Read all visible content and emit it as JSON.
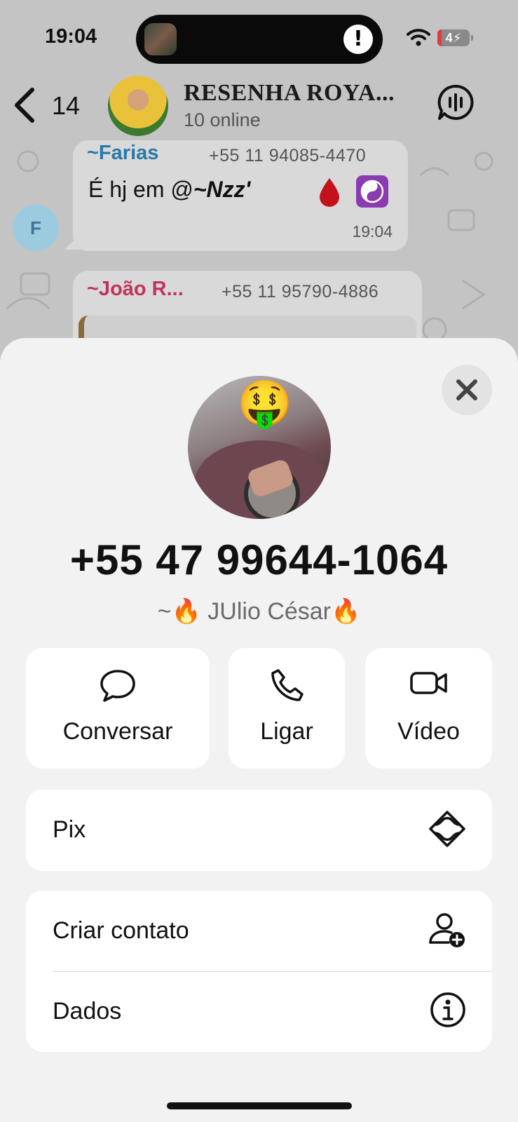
{
  "status_bar": {
    "time": "19:04",
    "alert_glyph": "!",
    "battery_level": "4"
  },
  "chat_header": {
    "back_count": "14",
    "group_name": "RESENHA ROYA...",
    "online": "10 online"
  },
  "messages": [
    {
      "sender": "~Farias",
      "sender_color": "#2a79a8",
      "phone": "+55 11 94085-4470",
      "text_prefix": "É hj em @",
      "mention": "~Nzz'",
      "time": "19:04",
      "avatar_letter": "F"
    },
    {
      "sender": "~João R...",
      "sender_color": "#c2335c",
      "phone": "+55 11 95790-4886"
    }
  ],
  "contact": {
    "phone": "+55 47 99644-1064",
    "name_prefix": "~",
    "name": "JUlio César",
    "name_emoji": "🔥"
  },
  "actions": [
    {
      "label": "Conversar",
      "icon": "chat-bubble-icon"
    },
    {
      "label": "Ligar",
      "icon": "phone-icon"
    },
    {
      "label": "Vídeo",
      "icon": "video-camera-icon"
    }
  ],
  "rows": {
    "pix": {
      "label": "Pix",
      "icon": "pix-icon"
    },
    "create_contact": {
      "label": "Criar contato",
      "icon": "add-contact-icon"
    },
    "details": {
      "label": "Dados",
      "icon": "info-icon"
    }
  },
  "colors": {
    "sheet_bg": "#f2f2f2",
    "card_bg": "#ffffff",
    "overlay": "#c4c4c4"
  }
}
